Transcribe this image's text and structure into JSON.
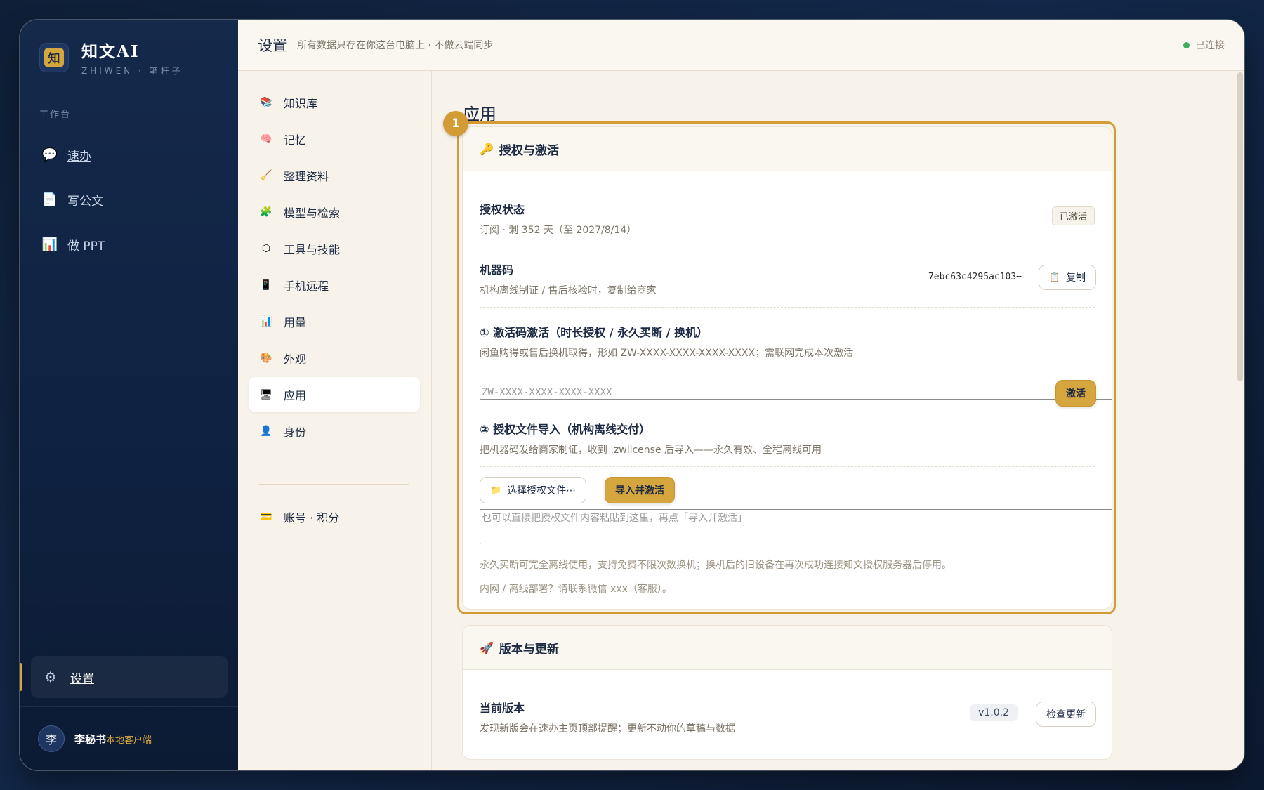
{
  "brand": {
    "logo_char": "知",
    "title": "知文AI",
    "subtitle": "ZHIWEN · 笔杆子"
  },
  "sidebar": {
    "section_label": "工作台",
    "items": [
      {
        "icon": "speech-bubble-icon",
        "glyph": "💬",
        "label": "速办"
      },
      {
        "icon": "document-icon",
        "glyph": "📄",
        "label": "写公文"
      },
      {
        "icon": "chart-icon",
        "glyph": "📊",
        "label": "做 PPT"
      }
    ],
    "settings": {
      "icon": "gear-icon",
      "glyph": "⚙",
      "label": "设置"
    },
    "user": {
      "avatar_char": "李",
      "name": "李秘书",
      "tag": "本地客户端"
    }
  },
  "topbar": {
    "title": "设置",
    "subtitle": "所有数据只存在你这台电脑上 · 不做云端同步",
    "status": "已连接",
    "status_color": "#3fae5a"
  },
  "settings_nav": {
    "items": [
      {
        "icon": "books-icon",
        "glyph": "📚",
        "label": "知识库"
      },
      {
        "icon": "brain-icon",
        "glyph": "🧠",
        "label": "记忆"
      },
      {
        "icon": "broom-icon",
        "glyph": "🧹",
        "label": "整理资料"
      },
      {
        "icon": "puzzle-icon",
        "glyph": "🧩",
        "label": "模型与检索"
      },
      {
        "icon": "hexagon-icon",
        "glyph": "⬡",
        "label": "工具与技能"
      },
      {
        "icon": "phone-icon",
        "glyph": "📱",
        "label": "手机远程"
      },
      {
        "icon": "bar-chart-icon",
        "glyph": "📊",
        "label": "用量"
      },
      {
        "icon": "palette-icon",
        "glyph": "🎨",
        "label": "外观"
      },
      {
        "icon": "monitor-icon",
        "glyph": "🖥",
        "label": "应用",
        "active": true
      },
      {
        "icon": "person-icon",
        "glyph": "👤",
        "label": "身份"
      }
    ],
    "account": {
      "icon": "card-icon",
      "glyph": "💳",
      "label": "账号 · 积分"
    }
  },
  "page": {
    "title": "应用",
    "step_badge": "1"
  },
  "license_card": {
    "icon": "key-icon",
    "glyph": "🔑",
    "title": "授权与激活",
    "status": {
      "title": "授权状态",
      "desc": "订阅 · 剩 352 天（至 2027/8/14）",
      "pill": "已激活"
    },
    "machine": {
      "title": "机器码",
      "desc": "机构离线制证 / 售后核验时，复制给商家",
      "code": "7ebc63c4295ac103⋯",
      "copy_label": "复制",
      "copy_glyph": "📋"
    },
    "activation": {
      "title": "① 激活码激活（时长授权 / 永久买断 / 换机）",
      "desc": "闲鱼购得或售后换机取得，形如 ZW-XXXX-XXXX-XXXX-XXXX；需联网完成本次激活",
      "placeholder": "ZW-XXXX-XXXX-XXXX-XXXX",
      "button": "激活"
    },
    "file_import": {
      "title": "② 授权文件导入（机构离线交付）",
      "desc": "把机器码发给商家制证，收到 .zwlicense 后导入——永久有效、全程离线可用",
      "choose_label": "选择授权文件⋯",
      "choose_glyph": "📁",
      "import_label": "导入并激活",
      "paste_placeholder": "也可以直接把授权文件内容粘贴到这里，再点「导入并激活」"
    },
    "note1": "永久买断可完全离线使用，支持免费不限次数换机；换机后的旧设备在再次成功连接知文授权服务器后停用。",
    "note2": "内网 / 离线部署？请联系微信 xxx（客服）。"
  },
  "version_card": {
    "icon": "rocket-icon",
    "glyph": "🚀",
    "title": "版本与更新",
    "current": {
      "title": "当前版本",
      "desc": "发现新版会在速办主页顶部提醒；更新不动你的草稿与数据",
      "version": "v1.0.2",
      "check_label": "检查更新"
    }
  },
  "colors": {
    "accent": "#d6a63e",
    "highlight": "#d29b33",
    "sidebar_bg": "#15294b"
  }
}
